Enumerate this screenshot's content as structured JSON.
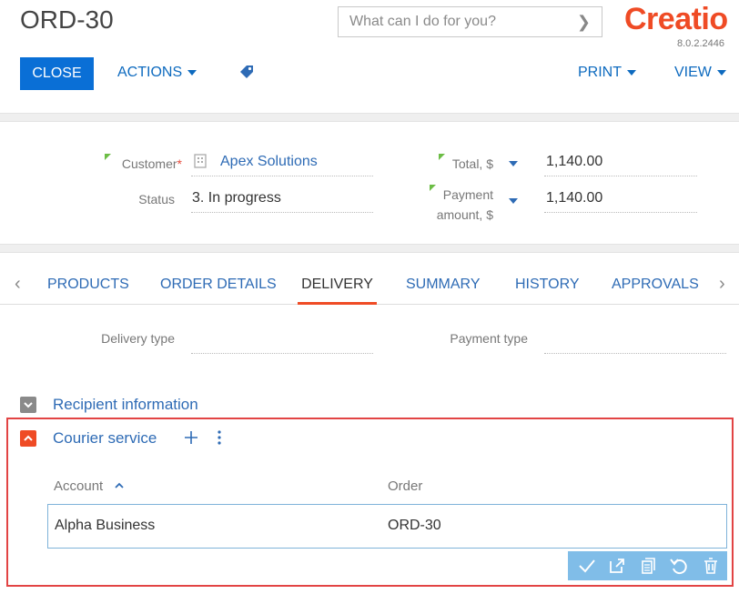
{
  "header": {
    "title": "ORD-30",
    "search_placeholder": "What can I do for you?",
    "logo": "Creatio",
    "version": "8.0.2.2446"
  },
  "toolbar": {
    "close_label": "CLOSE",
    "actions_label": "ACTIONS",
    "print_label": "PRINT",
    "view_label": "VIEW"
  },
  "fields": {
    "customer_label": "Customer",
    "customer_required": "*",
    "customer_value": "Apex Solutions",
    "status_label": "Status",
    "status_value": "3. In progress",
    "total_label": "Total, $",
    "total_value": "1,140.00",
    "payment_label_1": "Payment",
    "payment_label_2": "amount, $",
    "payment_value": "1,140.00"
  },
  "tabs": [
    "PRODUCTS",
    "ORDER DETAILS",
    "DELIVERY",
    "SUMMARY",
    "HISTORY",
    "APPROVALS"
  ],
  "delivery": {
    "delivery_type_label": "Delivery type",
    "payment_type_label": "Payment type"
  },
  "sections": {
    "recipient_title": "Recipient information",
    "courier_title": "Courier service"
  },
  "grid": {
    "col_account": "Account",
    "col_order": "Order",
    "rows": [
      {
        "account": "Alpha Business",
        "order": "ORD-30"
      }
    ]
  },
  "colors": {
    "accent": "#0a6fd6",
    "brand": "#ef4b25",
    "link": "#2e6bb5",
    "highlight_border": "#e24444"
  }
}
